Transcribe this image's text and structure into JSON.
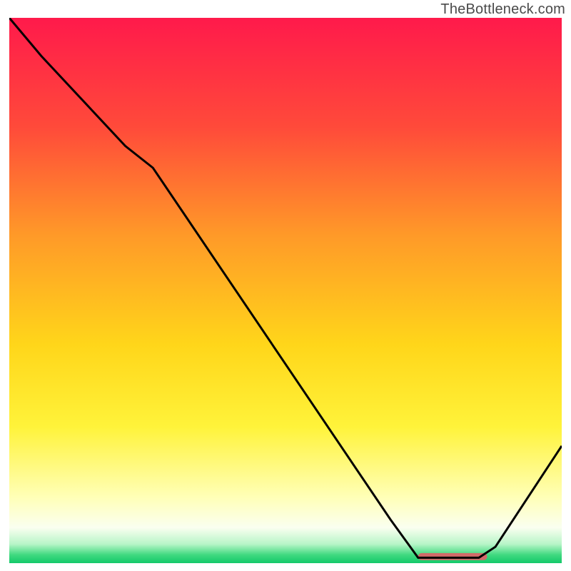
{
  "watermark": "TheBottleneck.com",
  "chart_data": {
    "type": "line",
    "title": "",
    "xlabel": "",
    "ylabel": "",
    "xlim": [
      0,
      100
    ],
    "ylim": [
      0,
      100
    ],
    "gradient_stops": [
      {
        "offset": 0.0,
        "color": "#ff1a4b"
      },
      {
        "offset": 0.2,
        "color": "#ff4a3a"
      },
      {
        "offset": 0.4,
        "color": "#ff9a28"
      },
      {
        "offset": 0.6,
        "color": "#ffd61a"
      },
      {
        "offset": 0.75,
        "color": "#fff33a"
      },
      {
        "offset": 0.88,
        "color": "#ffffb8"
      },
      {
        "offset": 0.935,
        "color": "#fafff0"
      },
      {
        "offset": 0.965,
        "color": "#b8f5c8"
      },
      {
        "offset": 0.985,
        "color": "#3fd97f"
      },
      {
        "offset": 1.0,
        "color": "#14c96a"
      }
    ],
    "series": [
      {
        "name": "curve",
        "x": [
          0.0,
          5.8,
          21.0,
          26.0,
          69.0,
          74.0,
          85.0,
          88.0,
          100.0
        ],
        "y": [
          100.0,
          93.0,
          76.5,
          72.5,
          8.0,
          1.0,
          1.0,
          3.0,
          21.5
        ]
      }
    ],
    "highlight_bar": {
      "x_start": 74.0,
      "x_end": 86.5,
      "y": 1.2,
      "height_pct": 1.3,
      "color": "#d26a6a"
    }
  }
}
